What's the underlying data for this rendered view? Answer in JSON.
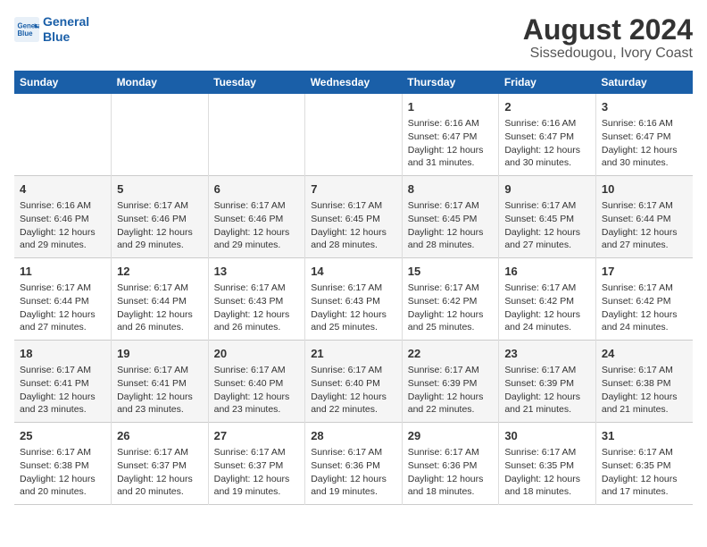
{
  "header": {
    "logo_line1": "General",
    "logo_line2": "Blue",
    "title": "August 2024",
    "subtitle": "Sissedougou, Ivory Coast"
  },
  "weekdays": [
    "Sunday",
    "Monday",
    "Tuesday",
    "Wednesday",
    "Thursday",
    "Friday",
    "Saturday"
  ],
  "weeks": [
    [
      {
        "day": "",
        "info": ""
      },
      {
        "day": "",
        "info": ""
      },
      {
        "day": "",
        "info": ""
      },
      {
        "day": "",
        "info": ""
      },
      {
        "day": "1",
        "info": "Sunrise: 6:16 AM\nSunset: 6:47 PM\nDaylight: 12 hours\nand 31 minutes."
      },
      {
        "day": "2",
        "info": "Sunrise: 6:16 AM\nSunset: 6:47 PM\nDaylight: 12 hours\nand 30 minutes."
      },
      {
        "day": "3",
        "info": "Sunrise: 6:16 AM\nSunset: 6:47 PM\nDaylight: 12 hours\nand 30 minutes."
      }
    ],
    [
      {
        "day": "4",
        "info": "Sunrise: 6:16 AM\nSunset: 6:46 PM\nDaylight: 12 hours\nand 29 minutes."
      },
      {
        "day": "5",
        "info": "Sunrise: 6:17 AM\nSunset: 6:46 PM\nDaylight: 12 hours\nand 29 minutes."
      },
      {
        "day": "6",
        "info": "Sunrise: 6:17 AM\nSunset: 6:46 PM\nDaylight: 12 hours\nand 29 minutes."
      },
      {
        "day": "7",
        "info": "Sunrise: 6:17 AM\nSunset: 6:45 PM\nDaylight: 12 hours\nand 28 minutes."
      },
      {
        "day": "8",
        "info": "Sunrise: 6:17 AM\nSunset: 6:45 PM\nDaylight: 12 hours\nand 28 minutes."
      },
      {
        "day": "9",
        "info": "Sunrise: 6:17 AM\nSunset: 6:45 PM\nDaylight: 12 hours\nand 27 minutes."
      },
      {
        "day": "10",
        "info": "Sunrise: 6:17 AM\nSunset: 6:44 PM\nDaylight: 12 hours\nand 27 minutes."
      }
    ],
    [
      {
        "day": "11",
        "info": "Sunrise: 6:17 AM\nSunset: 6:44 PM\nDaylight: 12 hours\nand 27 minutes."
      },
      {
        "day": "12",
        "info": "Sunrise: 6:17 AM\nSunset: 6:44 PM\nDaylight: 12 hours\nand 26 minutes."
      },
      {
        "day": "13",
        "info": "Sunrise: 6:17 AM\nSunset: 6:43 PM\nDaylight: 12 hours\nand 26 minutes."
      },
      {
        "day": "14",
        "info": "Sunrise: 6:17 AM\nSunset: 6:43 PM\nDaylight: 12 hours\nand 25 minutes."
      },
      {
        "day": "15",
        "info": "Sunrise: 6:17 AM\nSunset: 6:42 PM\nDaylight: 12 hours\nand 25 minutes."
      },
      {
        "day": "16",
        "info": "Sunrise: 6:17 AM\nSunset: 6:42 PM\nDaylight: 12 hours\nand 24 minutes."
      },
      {
        "day": "17",
        "info": "Sunrise: 6:17 AM\nSunset: 6:42 PM\nDaylight: 12 hours\nand 24 minutes."
      }
    ],
    [
      {
        "day": "18",
        "info": "Sunrise: 6:17 AM\nSunset: 6:41 PM\nDaylight: 12 hours\nand 23 minutes."
      },
      {
        "day": "19",
        "info": "Sunrise: 6:17 AM\nSunset: 6:41 PM\nDaylight: 12 hours\nand 23 minutes."
      },
      {
        "day": "20",
        "info": "Sunrise: 6:17 AM\nSunset: 6:40 PM\nDaylight: 12 hours\nand 23 minutes."
      },
      {
        "day": "21",
        "info": "Sunrise: 6:17 AM\nSunset: 6:40 PM\nDaylight: 12 hours\nand 22 minutes."
      },
      {
        "day": "22",
        "info": "Sunrise: 6:17 AM\nSunset: 6:39 PM\nDaylight: 12 hours\nand 22 minutes."
      },
      {
        "day": "23",
        "info": "Sunrise: 6:17 AM\nSunset: 6:39 PM\nDaylight: 12 hours\nand 21 minutes."
      },
      {
        "day": "24",
        "info": "Sunrise: 6:17 AM\nSunset: 6:38 PM\nDaylight: 12 hours\nand 21 minutes."
      }
    ],
    [
      {
        "day": "25",
        "info": "Sunrise: 6:17 AM\nSunset: 6:38 PM\nDaylight: 12 hours\nand 20 minutes."
      },
      {
        "day": "26",
        "info": "Sunrise: 6:17 AM\nSunset: 6:37 PM\nDaylight: 12 hours\nand 20 minutes."
      },
      {
        "day": "27",
        "info": "Sunrise: 6:17 AM\nSunset: 6:37 PM\nDaylight: 12 hours\nand 19 minutes."
      },
      {
        "day": "28",
        "info": "Sunrise: 6:17 AM\nSunset: 6:36 PM\nDaylight: 12 hours\nand 19 minutes."
      },
      {
        "day": "29",
        "info": "Sunrise: 6:17 AM\nSunset: 6:36 PM\nDaylight: 12 hours\nand 18 minutes."
      },
      {
        "day": "30",
        "info": "Sunrise: 6:17 AM\nSunset: 6:35 PM\nDaylight: 12 hours\nand 18 minutes."
      },
      {
        "day": "31",
        "info": "Sunrise: 6:17 AM\nSunset: 6:35 PM\nDaylight: 12 hours\nand 17 minutes."
      }
    ]
  ]
}
